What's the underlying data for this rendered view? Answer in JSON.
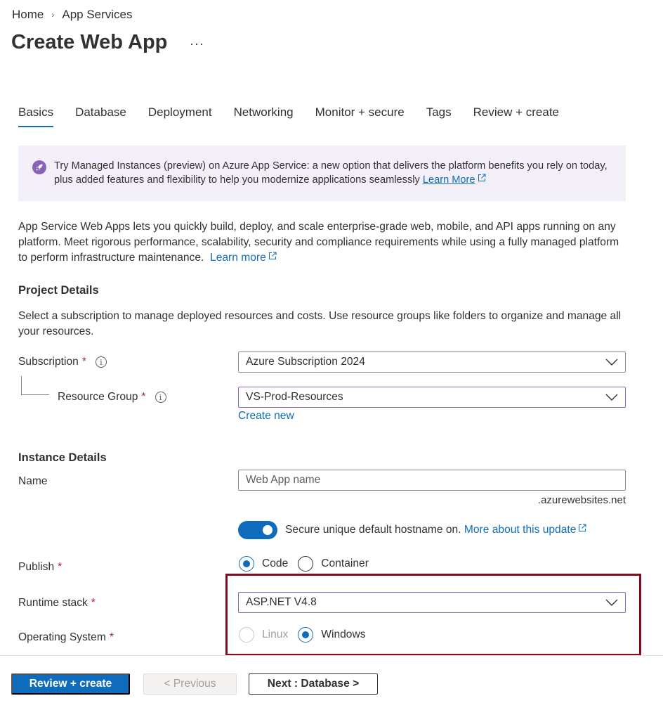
{
  "breadcrumb": {
    "items": [
      "Home",
      "App Services"
    ],
    "separator": "›"
  },
  "page": {
    "title": "Create Web App",
    "more": "···"
  },
  "tabs": [
    {
      "label": "Basics",
      "active": true
    },
    {
      "label": "Database",
      "active": false
    },
    {
      "label": "Deployment",
      "active": false
    },
    {
      "label": "Networking",
      "active": false
    },
    {
      "label": "Monitor + secure",
      "active": false
    },
    {
      "label": "Tags",
      "active": false
    },
    {
      "label": "Review + create",
      "active": false
    }
  ],
  "banner": {
    "icon": "rocket-icon",
    "text": "Try Managed Instances (preview) on Azure App Service: a new option that delivers the platform benefits you rely on today, plus added features and flexibility to help you modernize applications seamlessly",
    "link": "Learn More"
  },
  "intro": {
    "text": "App Service Web Apps lets you quickly build, deploy, and scale enterprise-grade web, mobile, and API apps running on any platform. Meet rigorous performance, scalability, security and compliance requirements while using a fully managed platform to perform infrastructure maintenance.",
    "link": "Learn more"
  },
  "project": {
    "title": "Project Details",
    "description": "Select a subscription to manage deployed resources and costs. Use resource groups like folders to organize and manage all your resources.",
    "subscription_label": "Subscription",
    "subscription_value": "Azure Subscription 2024",
    "resource_group_label": "Resource Group",
    "resource_group_value": "VS-Prod-Resources",
    "create_new": "Create new",
    "required_mark": "*",
    "info_glyph": "i"
  },
  "instance": {
    "title": "Instance Details",
    "name_label": "Name",
    "name_placeholder": "Web App name",
    "name_suffix": ".azurewebsites.net",
    "hostname_toggle_on": true,
    "hostname_text": "Secure unique default hostname on.",
    "hostname_link": "More about this update",
    "publish_label": "Publish",
    "publish_options": [
      "Code",
      "Container"
    ],
    "publish_selected": "Code",
    "runtime_label": "Runtime stack",
    "runtime_value": "ASP.NET V4.8",
    "os_label": "Operating System",
    "os_options": [
      "Linux",
      "Windows"
    ],
    "os_selected": "Windows"
  },
  "footer": {
    "review_create": "Review + create",
    "previous": "< Previous",
    "next": "Next : Database >"
  },
  "colors": {
    "accent": "#0f6cbd",
    "banner_bg": "#f3eff8",
    "banner_icon": "#8764b8",
    "highlight_border": "#7b0e23",
    "required": "#a4262c"
  }
}
